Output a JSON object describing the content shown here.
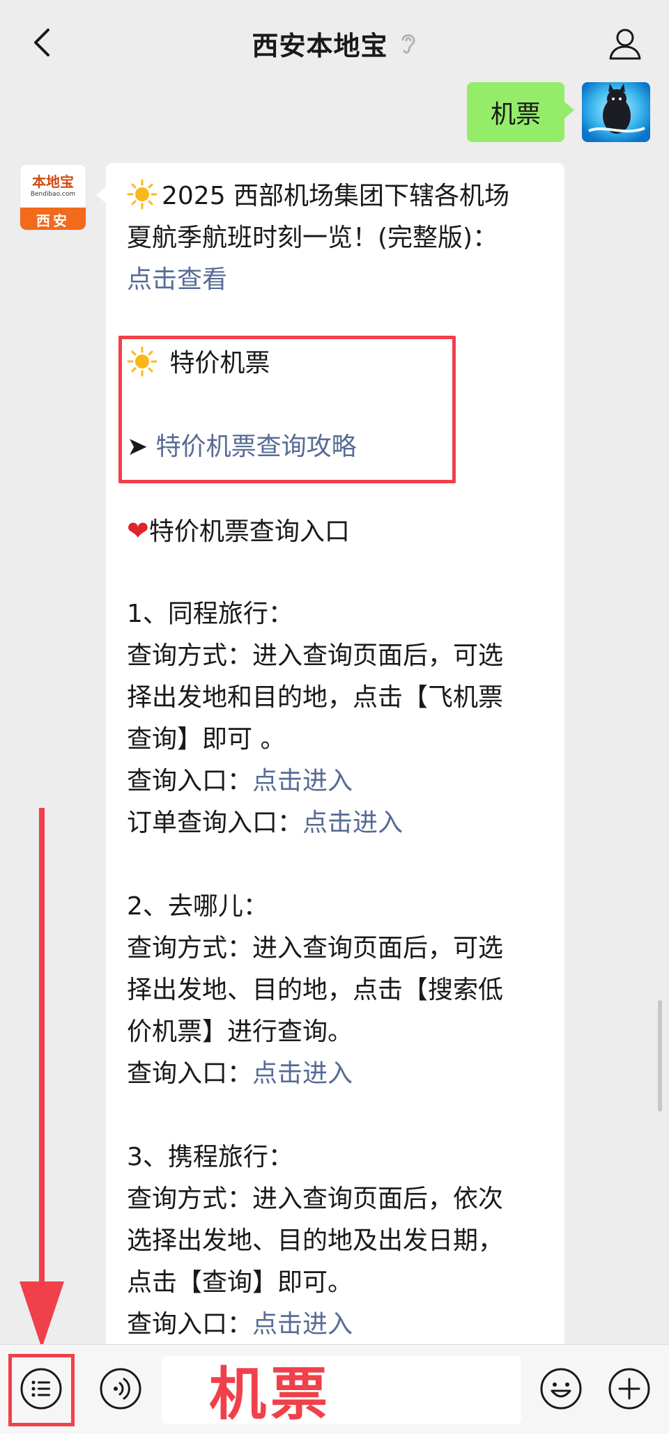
{
  "header": {
    "title": "西安本地宝",
    "back_icon": "chevron-left-icon",
    "ear_icon": "ear-icon",
    "user_icon": "person-icon"
  },
  "outgoing": {
    "text": "机票",
    "bubble_color": "#95ec69"
  },
  "account_avatar": {
    "name": "本地宝",
    "site": "Bendibao.com",
    "city": "西安",
    "brand_color": "#f26a1b"
  },
  "message": {
    "intro_prefix": "2025 西部机场集团下辖各机场",
    "intro_line2": "夏航季航班时刻一览！(完整版)：",
    "intro_link": "点击查看",
    "cheap_title": "特价机票",
    "cheap_link": "特价机票查询攻略",
    "entry_title": "特价机票查询入口",
    "items": [
      {
        "heading": "1、同程旅行：",
        "desc_lines": [
          "查询方式：进入查询页面后，可选",
          "择出发地和目的地，点击【飞机票",
          "查询】即可 。"
        ],
        "entries": [
          {
            "label": "查询入口：",
            "link": "点击进入"
          },
          {
            "label": "订单查询入口：",
            "link": "点击进入"
          }
        ]
      },
      {
        "heading": "2、去哪儿：",
        "desc_lines": [
          "查询方式：进入查询页面后，可选",
          "择出发地、目的地，点击【搜索低",
          "价机票】进行查询。"
        ],
        "entries": [
          {
            "label": "查询入口：",
            "link": "点击进入"
          }
        ]
      },
      {
        "heading": "3、携程旅行：",
        "desc_lines": [
          "查询方式：进入查询页面后，依次",
          "选择出发地、目的地及出发日期，",
          "点击【查询】即可。"
        ],
        "entries": [
          {
            "label": "查询入口：",
            "link": "点击进入"
          }
        ]
      }
    ],
    "link_color": "#576b95"
  },
  "bottom_bar": {
    "menu_icon": "list-menu-icon",
    "voice_icon": "voice-icon",
    "input_value": "机票",
    "emoji_icon": "smiley-icon",
    "plus_icon": "plus-circle-icon"
  },
  "annotation_color": "#f0404a"
}
